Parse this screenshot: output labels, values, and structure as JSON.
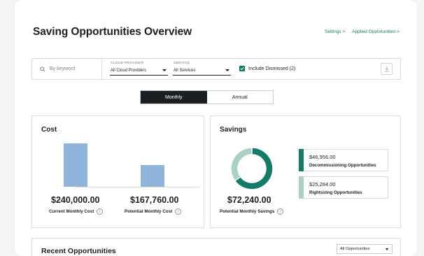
{
  "header": {
    "title": "Saving Opportunities Overview",
    "settings_link": "Settings >",
    "applied_link": "Applied Opportunities >"
  },
  "filters": {
    "search_placeholder": "By keyword",
    "cloud_provider": {
      "label": "CLOUD PROVIDER",
      "value": "All Cloud Providers"
    },
    "service": {
      "label": "SERVICE",
      "value": "All Services"
    },
    "include_dismissed": "Include Dismissed (2)",
    "include_dismissed_checked": true
  },
  "period_toggle": {
    "options": [
      "Monthly",
      "Annual"
    ],
    "selected": "Monthly"
  },
  "cost": {
    "title": "Cost",
    "current": {
      "amount": "$240,000.00",
      "label": "Current Monthly Cost",
      "value": 240000
    },
    "potential": {
      "amount": "$167,760.00",
      "label": "Potential Monthly Cost",
      "value": 167760
    }
  },
  "savings": {
    "title": "Savings",
    "total": "$72,240.00",
    "total_label": "Potential Monthly Savings",
    "items": [
      {
        "amount": "$46,956.00",
        "name": "Decommissioning Opportunities",
        "value": 46956,
        "color": "#137b67"
      },
      {
        "amount": "$25,284.00",
        "name": "Rightsizing Opportunities",
        "value": 25284,
        "color": "#a9cfc7"
      }
    ]
  },
  "recent": {
    "title": "Recent Opportunities",
    "filter_value": "All Opportunities"
  },
  "colors": {
    "accent": "#0f7a64",
    "bar": "#8fb5da",
    "dark": "#1a1f24"
  }
}
